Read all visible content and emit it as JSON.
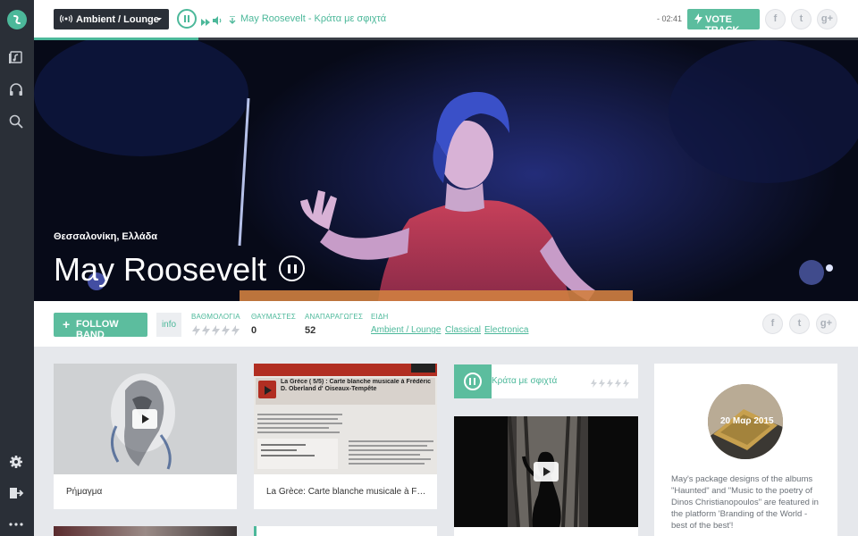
{
  "topbar": {
    "genre_selected": "Ambient / Lounge",
    "now_playing_artist": "May Roosevelt",
    "now_playing_separator": " - ",
    "now_playing_song": "Κράτα με σφιχτά",
    "time_remaining": "- 02:41",
    "vote_label": "VOTE TRACK",
    "progress_fraction": 0.2
  },
  "social": {
    "facebook": "f",
    "twitter": "t",
    "gplus": "g+"
  },
  "hero": {
    "location": "Θεσσαλονίκη, Ελλάδα",
    "artist_name": "May Roosevelt"
  },
  "infobar": {
    "follow_label": "FOLLOW BAND",
    "info_tab": "info",
    "rating_label": "ΒΑΘΜΟΛΟΓΙΑ",
    "fans_label": "ΘΑΥΜΑΣΤΕΣ",
    "fans_value": "0",
    "plays_label": "ΑΝΑΠΑΡΑΓΩΓΕΣ",
    "plays_value": "52",
    "genres_label": "ΕΙΔΗ",
    "genres": [
      "Ambient / Lounge",
      "Classical",
      "Electronica"
    ]
  },
  "cards": {
    "video1_title": "Ρήμαγμα",
    "news_title": "La Grèce: Carte blanche musicale à Fréd…",
    "news_header": "La Grèce ( 5/5) : Carte blanche musicale à Frédéric D. Oberland d' Oiseaux-Tempête",
    "now_playing_track": "Κράτα με σφιχτά",
    "event_date": "20 Μαρ 2015",
    "event_text": "May's package designs of the albums \"Haunted\" and \"Music to the poetry of Dinos Christianopoulos\" are featured in the platform 'Branding of the World - best of the best'!"
  },
  "colors": {
    "accent": "#4cb89a",
    "sidebar": "#2a2f37",
    "button": "#5cbd9e"
  },
  "icons": [
    "logo-icon",
    "playlist-icon",
    "headphones-icon",
    "search-icon",
    "settings-icon",
    "logout-icon",
    "more-icon"
  ]
}
